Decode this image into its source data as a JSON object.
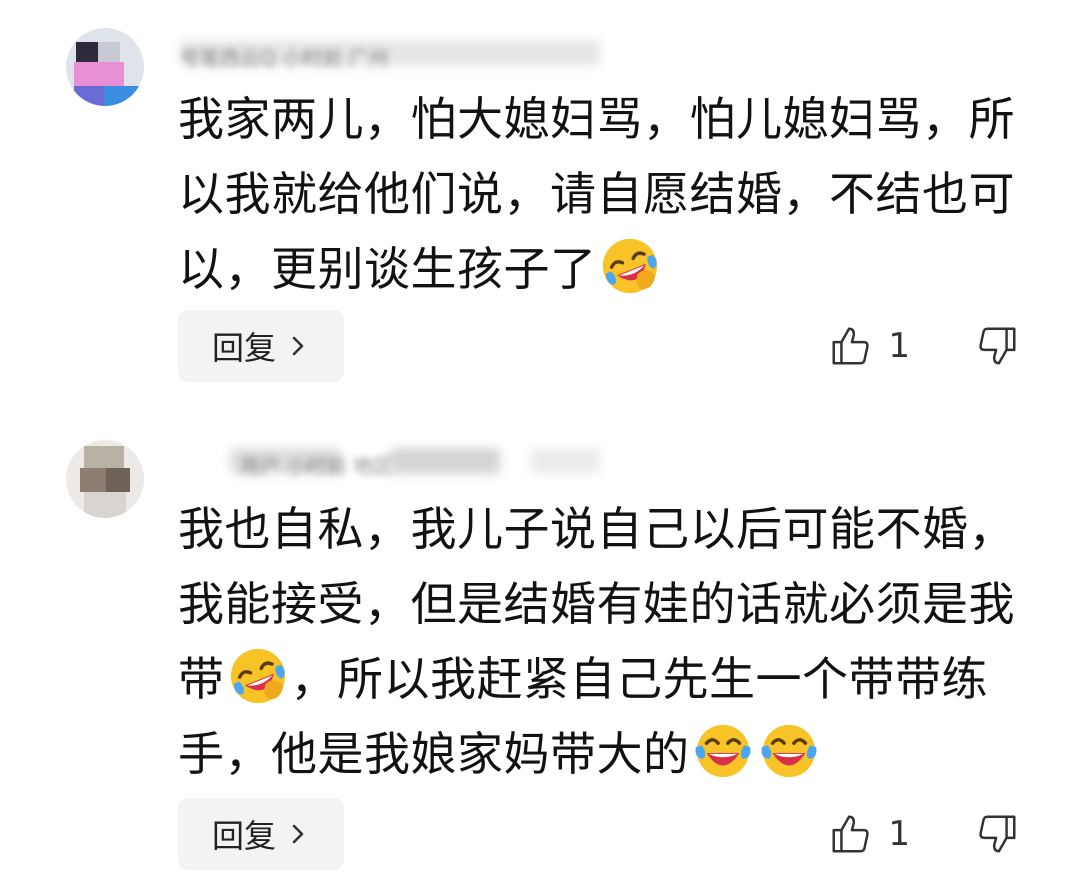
{
  "comments": [
    {
      "username_blurred": "号笔西云Q 小时前 广州",
      "text_parts": [
        "我家两儿，怕大媳妇骂，怕儿媳妇骂，所以我就给他们说，请自愿结婚，不结也可以，更别谈生孩子了"
      ],
      "emojis": [
        "laughing-crying-tilted-emoji"
      ],
      "reply_label": "回复",
      "like_count": "1",
      "avatar_colors": [
        "#e98fd6",
        "#6b6bd6",
        "#2b2b3d",
        "#3a8de0"
      ]
    },
    {
      "username_blurred": "用户 小时前 地区",
      "text_parts": [
        "我也自私，我儿子说自己以后可能不婚，我能接受，但是结婚有娃的话就必须是我带",
        "，所以我赶紧自己先生一个带带练手，他是我娘家妈带大的"
      ],
      "emojis": [
        "laughing-crying-tilted-emoji",
        "tears-of-joy-emoji",
        "tears-of-joy-emoji"
      ],
      "reply_label": "回复",
      "like_count": "1",
      "avatar_colors": [
        "#d9d4cf",
        "#8d7d72",
        "#b9b0a6",
        "#6f6258"
      ]
    }
  ],
  "colors": {
    "reply_bg": "#f3f3f3",
    "text": "#121212",
    "emoji_yellow": "#f7c326",
    "emoji_tear": "#4aa6f0",
    "emoji_mouth": "#d9304a"
  }
}
